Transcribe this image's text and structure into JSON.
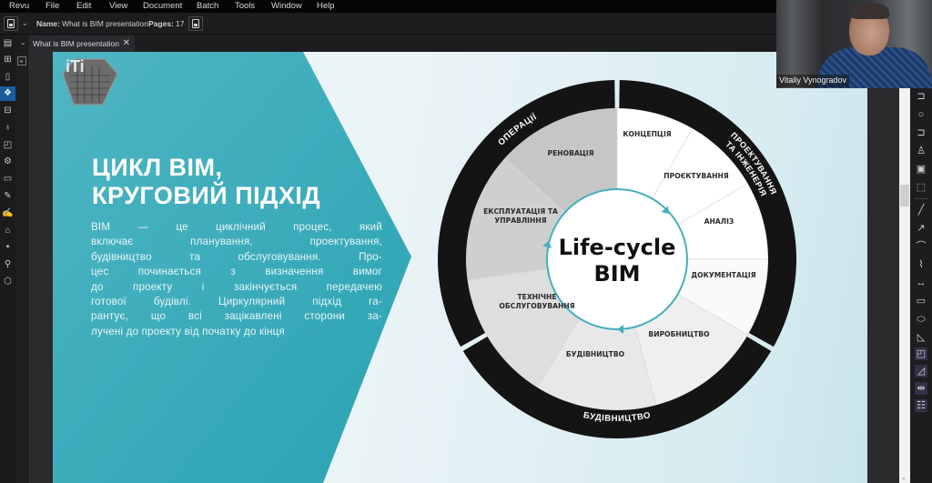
{
  "app": {
    "menu": [
      "Revu",
      "File",
      "Edit",
      "View",
      "Document",
      "Batch",
      "Tools",
      "Window",
      "Help"
    ]
  },
  "toolbar": {
    "name_label": "Name:",
    "name_value": "What is BIM presentation",
    "pages_label": "Pages:",
    "pages_value": "17"
  },
  "tabs": [
    {
      "label": "What is BIM presentation",
      "active": true,
      "close": "✕"
    }
  ],
  "left_sidebar": {
    "icons": [
      "thumbnails-icon",
      "bookmarks-icon",
      "layers-icon",
      "toolchest-icon",
      "markups-icon",
      "sketch-icon",
      "studio-icon",
      "measure-icon",
      "forms-icon",
      "signatures-icon",
      "tags-icon",
      "file-access-icon",
      "search-icon",
      "spaces-icon"
    ],
    "active": "layers-icon"
  },
  "right_tools": {
    "icons": [
      "text-box-icon",
      "circle-icon",
      "callout-icon",
      "stamp-icon",
      "image-icon",
      "crop-icon",
      "line-icon",
      "arrow-icon",
      "arc-icon",
      "polyline-icon",
      "dimension-icon",
      "rectangle-icon",
      "ellipse-icon",
      "polygon-icon",
      "area-icon",
      "sector-icon",
      "length-icon",
      "count-icon"
    ]
  },
  "webcam": {
    "participant_name": "Vitaliy Vynogradov"
  },
  "slide": {
    "title_lines": [
      "ЦИКЛ BIM,",
      "КРУГОВИЙ ПІДХІД"
    ],
    "body_lines": [
      "BIM — це циклічний процес, який",
      "включає планування, проектування,",
      "будівництво та обслуговування. Про-",
      "цес починається з визначення вимог",
      "до проекту і закінчується передачею",
      "готової будівлі. Циркулярний підхід га-",
      "рантує, що всі зацікавлені сторони за-",
      "лучені до проекту від початку до кінця"
    ],
    "colors": {
      "teal": "#3aa9b9",
      "ring": "#141414",
      "cycle_arrow": "#45aebd"
    },
    "diagram": {
      "center_lines": [
        "Life-cycle",
        "BIM"
      ],
      "ring_labels": {
        "operations": "ОПЕРАЦІЇ",
        "design_line1": "ПРОЕКТУВАННЯ",
        "design_line2": "ТА ІНЖЕНЕРІЯ",
        "construction": "БУДІВНИЦТВО"
      },
      "stages": [
        {
          "lines": [
            "КОНЦЕПЦІЯ"
          ]
        },
        {
          "lines": [
            "ПРОЄКТУВАННЯ"
          ]
        },
        {
          "lines": [
            "АНАЛІЗ"
          ]
        },
        {
          "lines": [
            "ДОКУМЕНТАЦІЯ"
          ]
        },
        {
          "lines": [
            "ВИРОБНИЦТВО"
          ]
        },
        {
          "lines": [
            "БУДІВНИЦТВО"
          ]
        },
        {
          "lines": [
            "ТЕХНІЧНЕ",
            "ОБСЛУГОВУВАННЯ"
          ]
        },
        {
          "lines": [
            "ЕКСПЛУАТАЦІЯ ТА",
            "УПРАВЛІННЯ"
          ]
        },
        {
          "lines": [
            "РЕНОВАЦІЯ"
          ]
        }
      ]
    }
  }
}
